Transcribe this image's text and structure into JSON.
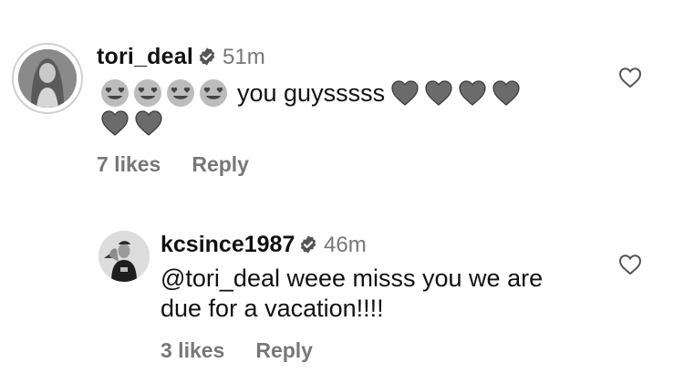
{
  "comments": [
    {
      "username": "tori_deal",
      "verified": true,
      "time": "51m",
      "text": "you guysssss",
      "leading_emoji": [
        "heart-eyes-emoji",
        "heart-eyes-emoji",
        "heart-eyes-emoji",
        "heart-eyes-emoji"
      ],
      "trailing_emoji": [
        "grey-heart",
        "grey-heart",
        "grey-heart",
        "grey-heart",
        "grey-heart",
        "grey-heart"
      ],
      "likes": "7 likes",
      "reply_label": "Reply"
    },
    {
      "username": "kcsince1987",
      "verified": true,
      "time": "46m",
      "text_line1": "@tori_deal weee misss you we are",
      "text_line2": "due for a vacation!!!!",
      "likes": "3 likes",
      "reply_label": "Reply"
    }
  ],
  "icons": {
    "verified": "verified-badge-icon",
    "like": "heart-outline-icon"
  },
  "colors": {
    "text": "#111111",
    "secondary": "#777777",
    "heart": "#6b6b6b"
  }
}
